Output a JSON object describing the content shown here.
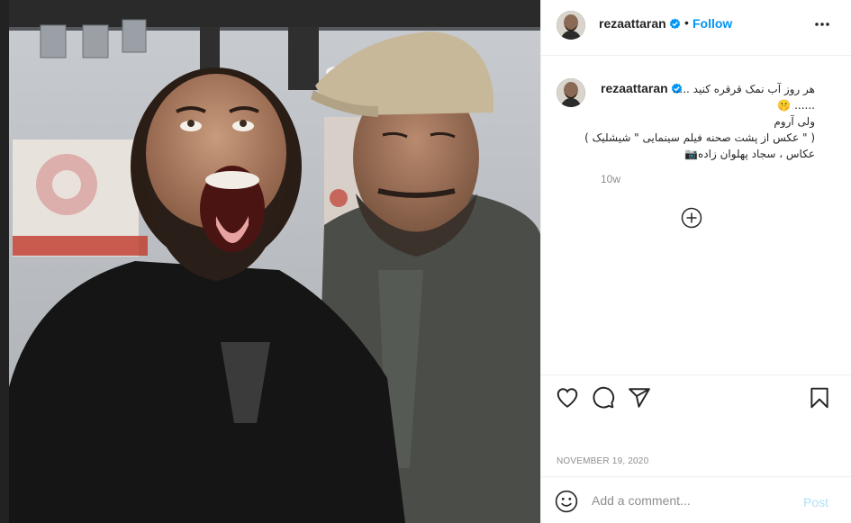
{
  "post": {
    "username": "rezaattaran",
    "dot": "•",
    "follow_label": "Follow",
    "more_icon": "more-options-icon",
    "verified_color": "#0095f6"
  },
  "caption": {
    "username": "rezaattaran",
    "lines": [
      "هر روز آب نمک قرقره کنید .....",
      "...... 🤫",
      "ولی آروم",
      "( \" عکس از پشت صحنه فیلم سینمایی \" شیشلیک )",
      "عکاس ، سجاد پهلوان زاده📷"
    ],
    "time_ago": "10w"
  },
  "actions": {
    "like_icon": "heart-icon",
    "comment_icon": "comment-icon",
    "share_icon": "share-icon",
    "save_icon": "bookmark-icon",
    "date": "NOVEMBER 19, 2020"
  },
  "comment": {
    "placeholder": "Add a comment...",
    "post_label": "Post",
    "post_color": "#b2dffc"
  },
  "colors": {
    "link_blue": "#0095f6",
    "muted": "#8e8e8e",
    "border": "#efefef"
  }
}
